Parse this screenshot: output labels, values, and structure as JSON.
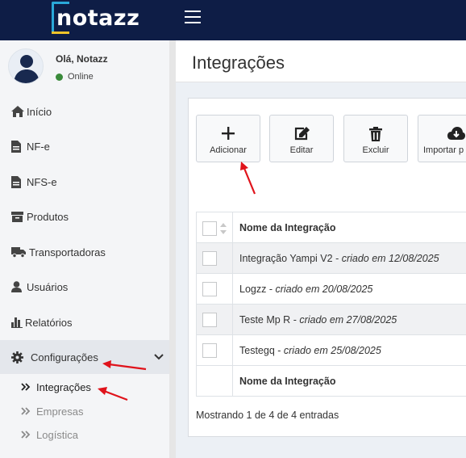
{
  "brand": {
    "logo_text": "notazz"
  },
  "user": {
    "greeting": "Olá, Notazz",
    "status": "Online",
    "status_color": "#3a8a3a"
  },
  "sidebar": {
    "items": [
      {
        "label": "Início",
        "icon": "home-icon"
      },
      {
        "label": "NF-e",
        "icon": "file-icon"
      },
      {
        "label": "NFS-e",
        "icon": "file-icon"
      },
      {
        "label": "Produtos",
        "icon": "archive-icon"
      },
      {
        "label": "Transportadoras",
        "icon": "truck-icon"
      },
      {
        "label": "Usuários",
        "icon": "user-icon"
      },
      {
        "label": "Relatórios",
        "icon": "bar-chart-icon"
      },
      {
        "label": "Configurações",
        "icon": "gear-icon"
      }
    ],
    "submenu": [
      {
        "label": "Integrações"
      },
      {
        "label": "Empresas"
      },
      {
        "label": "Logística"
      }
    ]
  },
  "page": {
    "title": "Integrações"
  },
  "toolbar": {
    "add": "Adicionar",
    "edit": "Editar",
    "delete": "Excluir",
    "import": "Importar p"
  },
  "table": {
    "header": "Nome da Integração",
    "footer_header": "Nome da Integração",
    "rows": [
      {
        "name": "Integração Yampi V2",
        "created": "criado em 12/08/2025"
      },
      {
        "name": "Logzz",
        "created": "criado em 20/08/2025"
      },
      {
        "name": "Teste Mp R",
        "created": "criado em 27/08/2025"
      },
      {
        "name": "Testegq",
        "created": "criado em 25/08/2025"
      }
    ],
    "separator": " - "
  },
  "pagination": {
    "info": "Mostrando 1 de 4 de 4 entradas"
  },
  "colors": {
    "topbar": "#0e1d46",
    "annotation_arrow": "#e0131b"
  }
}
